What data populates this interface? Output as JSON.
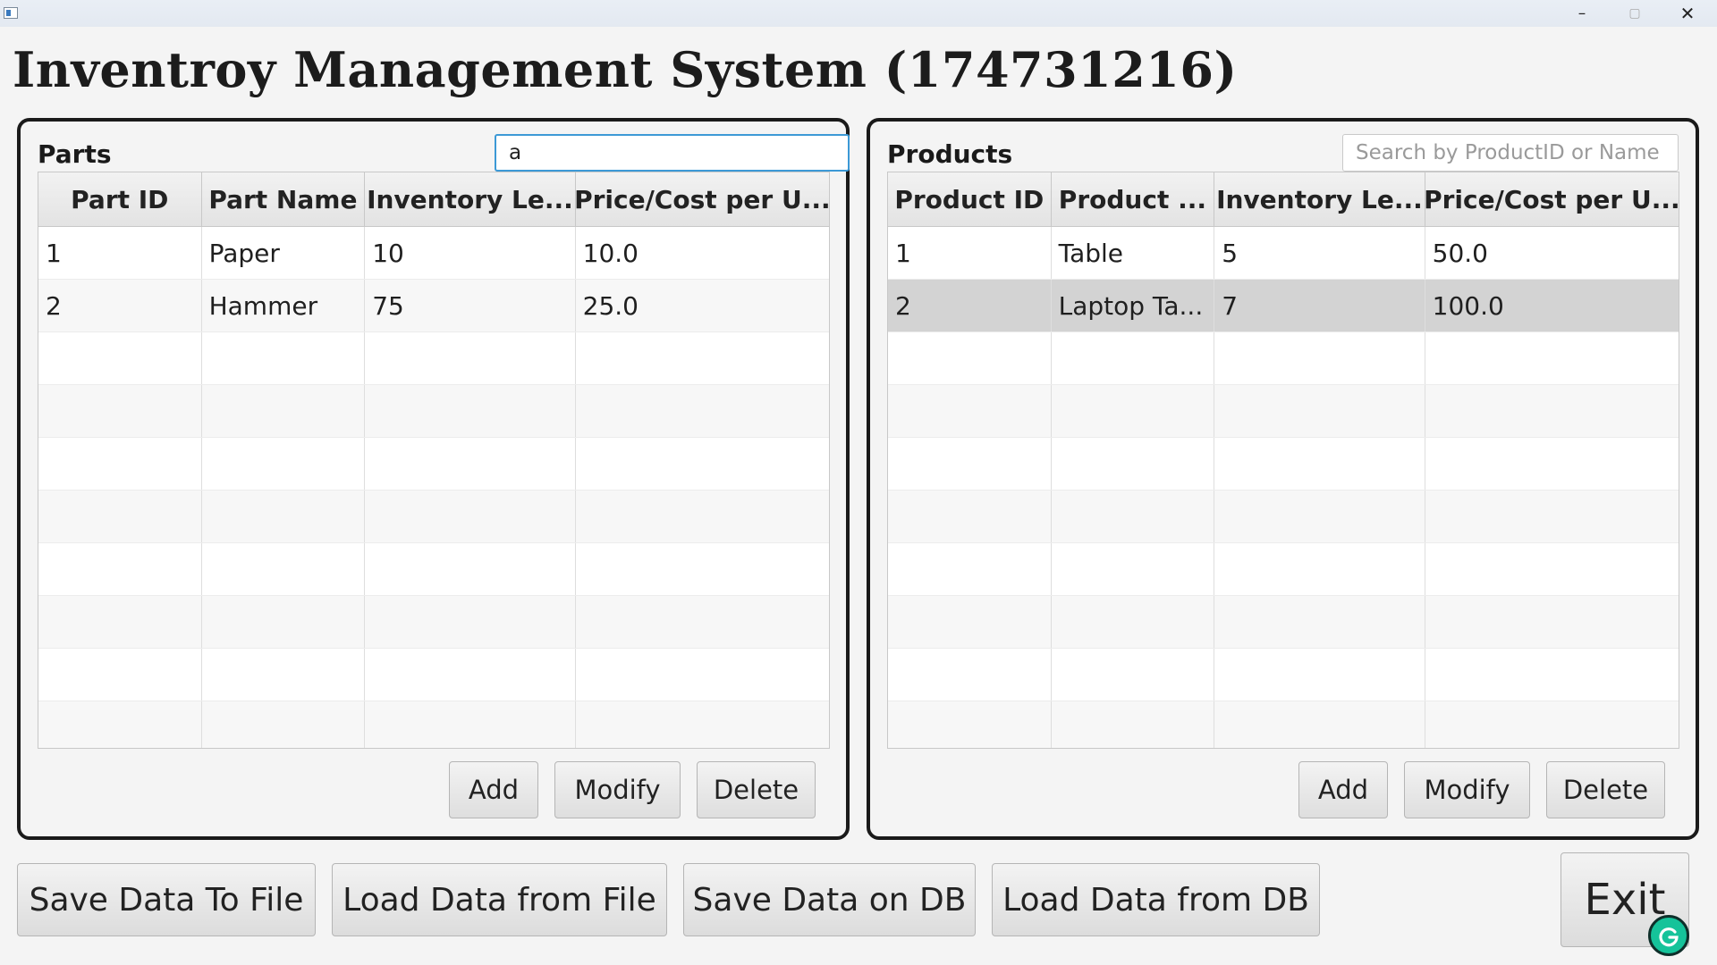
{
  "window": {
    "minimize_glyph": "–",
    "maximize_glyph": "▢",
    "close_glyph": "✕"
  },
  "page_title": "Inventroy Management System (174731216)",
  "parts": {
    "label": "Parts",
    "search": {
      "value": "a",
      "placeholder": ""
    },
    "columns": [
      "Part ID",
      "Part Name",
      "Inventory Le...",
      "Price/Cost per U..."
    ],
    "rows": [
      [
        "1",
        "Paper",
        "10",
        "10.0"
      ],
      [
        "2",
        "Hammer",
        "75",
        "25.0"
      ]
    ],
    "buttons": {
      "add": "Add",
      "modify": "Modify",
      "delete": "Delete"
    }
  },
  "products": {
    "label": "Products",
    "search": {
      "value": "",
      "placeholder": "Search by ProductID or Name"
    },
    "columns": [
      "Product ID",
      "Product ...",
      "Inventory Le...",
      "Price/Cost per U..."
    ],
    "rows": [
      [
        "1",
        "Table",
        "5",
        "50.0"
      ],
      [
        "2",
        "Laptop Ta...",
        "7",
        "100.0"
      ]
    ],
    "selected_row": 2,
    "buttons": {
      "add": "Add",
      "modify": "Modify",
      "delete": "Delete"
    }
  },
  "bottom_buttons": {
    "save_file": "Save Data To File",
    "load_file": "Load Data from File",
    "save_db": "Save Data on DB",
    "load_db": "Load Data from DB",
    "exit": "Exit"
  },
  "colors": {
    "search_focus": "#3c99d6",
    "selected_row": "#d3d3d3",
    "grammarly": "#15c39a"
  }
}
